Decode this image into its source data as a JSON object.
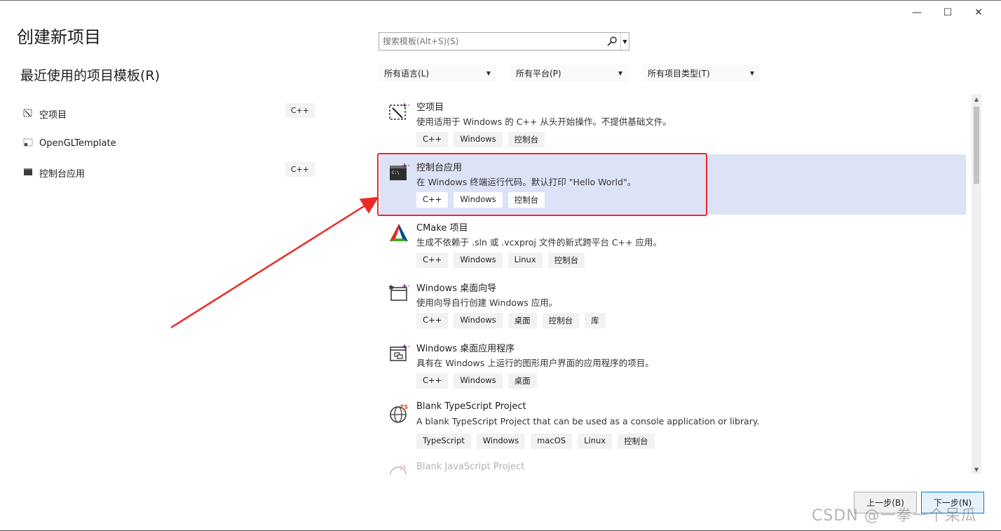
{
  "window": {
    "controls": {
      "minimize": "—",
      "maximize": "☐",
      "close": "✕"
    }
  },
  "header": {
    "title": "创建新项目",
    "recent_title": "最近使用的项目模板(R)"
  },
  "search": {
    "placeholder": "搜索模板(Alt+S)(S)"
  },
  "filters": [
    {
      "label": "所有语言(L)"
    },
    {
      "label": "所有平台(P)"
    },
    {
      "label": "所有项目类型(T)"
    }
  ],
  "recent": [
    {
      "name": "空项目",
      "tag": "C++",
      "icon": "empty-project-icon"
    },
    {
      "name": "OpenGLTemplate",
      "tag": "",
      "icon": "opengl-template-icon"
    },
    {
      "name": "控制台应用",
      "tag": "C++",
      "icon": "console-app-icon"
    }
  ],
  "templates": [
    {
      "name": "空项目",
      "desc": "使用适用于 Windows 的 C++ 从头开始操作。不提供基础文件。",
      "tags": [
        "C++",
        "Windows",
        "控制台"
      ],
      "icon": "empty-project-icon"
    },
    {
      "name": "控制台应用",
      "desc": "在 Windows 终端运行代码。默认打印 \"Hello World\"。",
      "tags": [
        "C++",
        "Windows",
        "控制台"
      ],
      "icon": "console-app-icon"
    },
    {
      "name": "CMake 项目",
      "desc": "生成不依赖于 .sln 或 .vcxproj 文件的新式跨平台 C++ 应用。",
      "tags": [
        "C++",
        "Windows",
        "Linux",
        "控制台"
      ],
      "icon": "cmake-icon"
    },
    {
      "name": "Windows 桌面向导",
      "desc": "使用向导自行创建 Windows 应用。",
      "tags": [
        "C++",
        "Windows",
        "桌面",
        "控制台",
        "库"
      ],
      "icon": "desktop-wizard-icon"
    },
    {
      "name": "Windows 桌面应用程序",
      "desc": "具有在 Windows 上运行的图形用户界面的应用程序的项目。",
      "tags": [
        "C++",
        "Windows",
        "桌面"
      ],
      "icon": "desktop-app-icon"
    },
    {
      "name": "Blank TypeScript Project",
      "desc": "A blank TypeScript Project that can be used as a console application or library.",
      "tags": [
        "TypeScript",
        "Windows",
        "macOS",
        "Linux",
        "控制台"
      ],
      "icon": "typescript-icon"
    },
    {
      "name": "Blank JavaScript Project",
      "desc": "",
      "tags": [],
      "icon": "javascript-icon"
    }
  ],
  "buttons": {
    "back": "上一步(B)",
    "next": "下一步(N)"
  },
  "watermark": "CSDN @一拳一个呆瓜",
  "colors": {
    "selected_bg": "#dde3f7",
    "highlight": "#ee2a24",
    "accent": "#0078d7"
  }
}
